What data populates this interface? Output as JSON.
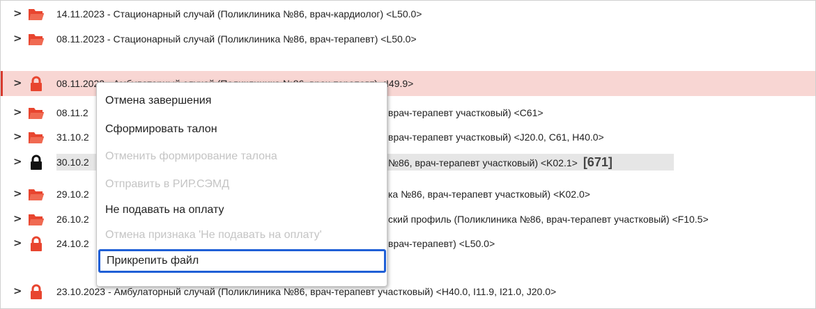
{
  "colors": {
    "folder": "#e8452f",
    "lock_red": "#e8452f",
    "lock_black": "#111111",
    "selected_row_bg": "#f8d6d3",
    "focus_outline": "#1f5fd6"
  },
  "rows": [
    {
      "icon": "open-folder-icon",
      "text": "14.11.2023 - Стационарный случай (Поликлиника №86, врач-кардиолог) <L50.0>"
    },
    {
      "icon": "open-folder-icon",
      "text": "08.11.2023 - Стационарный случай (Поликлиника №86, врач-терапевт) <L50.0>"
    },
    {
      "icon": "red-lock-icon",
      "text": "08.11.2023 - Амбулаторный случай (Поликлиника №86, врач-терапевт) <I49.9>"
    },
    {
      "icon": "open-folder-icon",
      "text": "08.11.2",
      "tail": "врач-терапевт участковый) <C61>"
    },
    {
      "icon": "open-folder-icon",
      "text": "31.10.2",
      "tail": "врач-терапевт участковый) <J20.0, C61, H40.0>"
    },
    {
      "icon": "black-lock-icon",
      "text": "30.10.2",
      "tail": "№86, врач-терапевт участковый) <K02.1>",
      "badge": "[671]"
    },
    {
      "icon": "open-folder-icon",
      "text": "29.10.2",
      "tail": "ка №86, врач-терапевт участковый) <K02.0>"
    },
    {
      "icon": "open-folder-icon",
      "text": "26.10.2",
      "tail": "ский профиль (Поликлиника №86, врач-терапевт участковый) <F10.5>"
    },
    {
      "icon": "red-lock-icon",
      "text": "24.10.2",
      "tail": "врач-терапевт) <L50.0>"
    },
    {
      "icon": "red-lock-icon",
      "text": "23.10.2023 - Амбулаторный случай (Поликлиника №86, врач-терапевт участковый) <H40.0, I11.9, I21.0, J20.0>"
    }
  ],
  "context_menu": {
    "items": [
      {
        "label": "Отмена завершения",
        "state": "enabled"
      },
      {
        "label": "Сформировать талон",
        "state": "enabled"
      },
      {
        "label": "Отменить формирование талона",
        "state": "disabled"
      },
      {
        "label": "Отправить в РИР.СЭМД",
        "state": "disabled"
      },
      {
        "label": "Не подавать на оплату",
        "state": "enabled"
      },
      {
        "label": "Отмена признака 'Не подавать на оплату'",
        "state": "disabled"
      },
      {
        "label": "Прикрепить файл",
        "state": "focused"
      }
    ]
  }
}
